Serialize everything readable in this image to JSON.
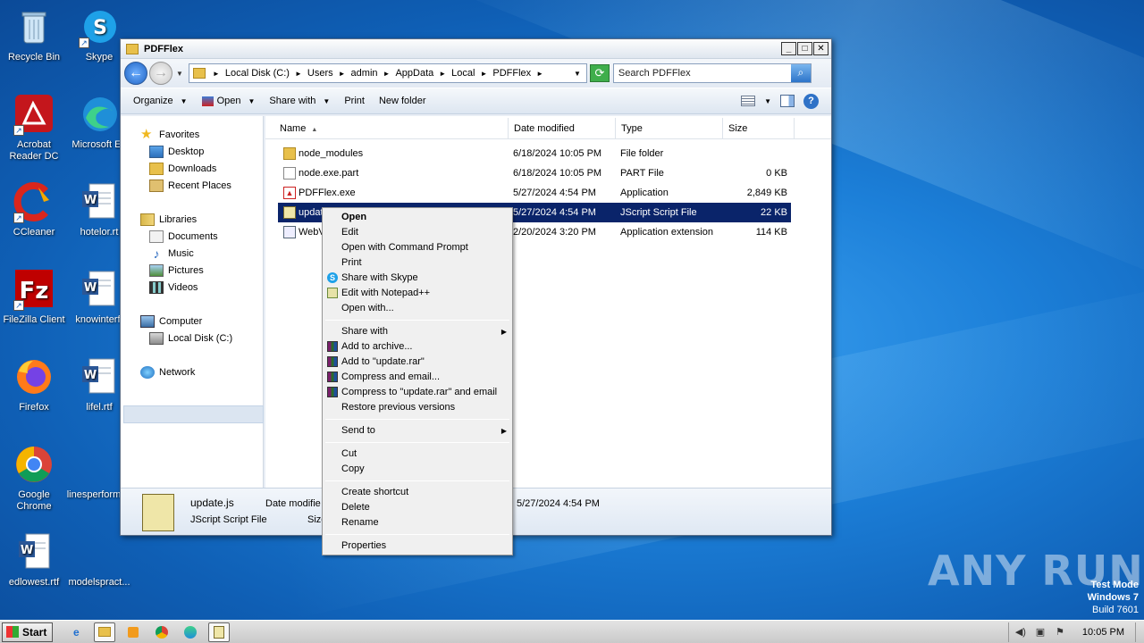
{
  "desktop_icons": [
    {
      "label": "Recycle Bin",
      "icon": "recycle-bin-icon"
    },
    {
      "label": "Skype",
      "icon": "skype-icon"
    },
    {
      "label": "Acrobat Reader DC",
      "label_line1": "Acrobat",
      "label_line2": "Reader DC",
      "icon": "acrobat-icon"
    },
    {
      "label": "Microsoft Ed",
      "icon": "edge-icon"
    },
    {
      "label": "CCleaner",
      "icon": "ccleaner-icon"
    },
    {
      "label": "hotelor.rt",
      "icon": "word-doc-icon"
    },
    {
      "label": "FileZilla Client",
      "icon": "filezilla-icon"
    },
    {
      "label": "knowinterf.",
      "icon": "word-doc-icon"
    },
    {
      "label": "Firefox",
      "icon": "firefox-icon"
    },
    {
      "label": "lifel.rtf",
      "icon": "word-doc-icon"
    },
    {
      "label": "Google Chrome",
      "label_line1": "Google",
      "label_line2": "Chrome",
      "icon": "chrome-icon"
    },
    {
      "label": "linesperform",
      "icon": "blank-file-icon"
    },
    {
      "label": "edlowest.rtf",
      "icon": "word-doc-icon"
    },
    {
      "label": "modelspract...",
      "icon": "blank-file-icon"
    }
  ],
  "window": {
    "title": "PDFFlex",
    "buttons": {
      "minimize": "_",
      "maximize": "□",
      "close": "✕"
    }
  },
  "address": {
    "crumbs": [
      "Local Disk (C:)",
      "Users",
      "admin",
      "AppData",
      "Local",
      "PDFFlex"
    ],
    "search_placeholder": "Search PDFFlex"
  },
  "toolbar": {
    "organize": "Organize",
    "open": "Open",
    "share_with": "Share with",
    "print": "Print",
    "new_folder": "New folder"
  },
  "nav": {
    "favorites": "Favorites",
    "desktop": "Desktop",
    "downloads": "Downloads",
    "recent_places": "Recent Places",
    "libraries": "Libraries",
    "documents": "Documents",
    "music": "Music",
    "pictures": "Pictures",
    "videos": "Videos",
    "computer": "Computer",
    "local_disk": "Local Disk (C:)",
    "network": "Network"
  },
  "columns": {
    "name": "Name",
    "date": "Date modified",
    "type": "Type",
    "size": "Size"
  },
  "files": [
    {
      "name": "node_modules",
      "date": "6/18/2024 10:05 PM",
      "type": "File folder",
      "size": "",
      "icon": "folder-icon"
    },
    {
      "name": "node.exe.part",
      "date": "6/18/2024 10:05 PM",
      "type": "PART File",
      "size": "0 KB",
      "icon": "file-icon"
    },
    {
      "name": "PDFFlex.exe",
      "date": "5/27/2024 4:54 PM",
      "type": "Application",
      "size": "2,849 KB",
      "icon": "pdf-app-icon"
    },
    {
      "name": "updat",
      "date": "5/27/2024 4:54 PM",
      "type": "JScript Script File",
      "size": "22 KB",
      "icon": "jscript-icon",
      "selected": true
    },
    {
      "name": "WebV",
      "date": "2/20/2024 3:20 PM",
      "type": "Application extension",
      "size": "114 KB",
      "icon": "dll-icon"
    }
  ],
  "details": {
    "filename": "update.js",
    "filetype": "JScript Script File",
    "date_label": "Date modifie",
    "date_value": "5/27/2024 4:54 PM",
    "size_label": "Size"
  },
  "context_menu": [
    {
      "label": "Open",
      "bold": true
    },
    {
      "label": "Edit"
    },
    {
      "label": "Open with Command Prompt"
    },
    {
      "label": "Print"
    },
    {
      "label": "Share with Skype",
      "icon": "skype-icon"
    },
    {
      "label": "Edit with Notepad++",
      "icon": "notepad-plus-plus-icon"
    },
    {
      "label": "Open with..."
    },
    {
      "separator": true
    },
    {
      "label": "Share with",
      "submenu": true
    },
    {
      "label": "Add to archive...",
      "icon": "winrar-icon"
    },
    {
      "label": "Add to \"update.rar\"",
      "icon": "winrar-icon"
    },
    {
      "label": "Compress and email...",
      "icon": "winrar-icon"
    },
    {
      "label": "Compress to \"update.rar\" and email",
      "icon": "winrar-icon"
    },
    {
      "label": "Restore previous versions"
    },
    {
      "separator": true
    },
    {
      "label": "Send to",
      "submenu": true
    },
    {
      "separator": true
    },
    {
      "label": "Cut"
    },
    {
      "label": "Copy"
    },
    {
      "separator": true
    },
    {
      "label": "Create shortcut"
    },
    {
      "label": "Delete"
    },
    {
      "label": "Rename"
    },
    {
      "separator": true
    },
    {
      "label": "Properties"
    }
  ],
  "taskbar": {
    "start": "Start",
    "clock": "10:05 PM"
  },
  "watermark": "ANY RUN",
  "testmode": {
    "line1": "Test Mode",
    "line2": "Windows 7",
    "line3": "Build 7601"
  }
}
